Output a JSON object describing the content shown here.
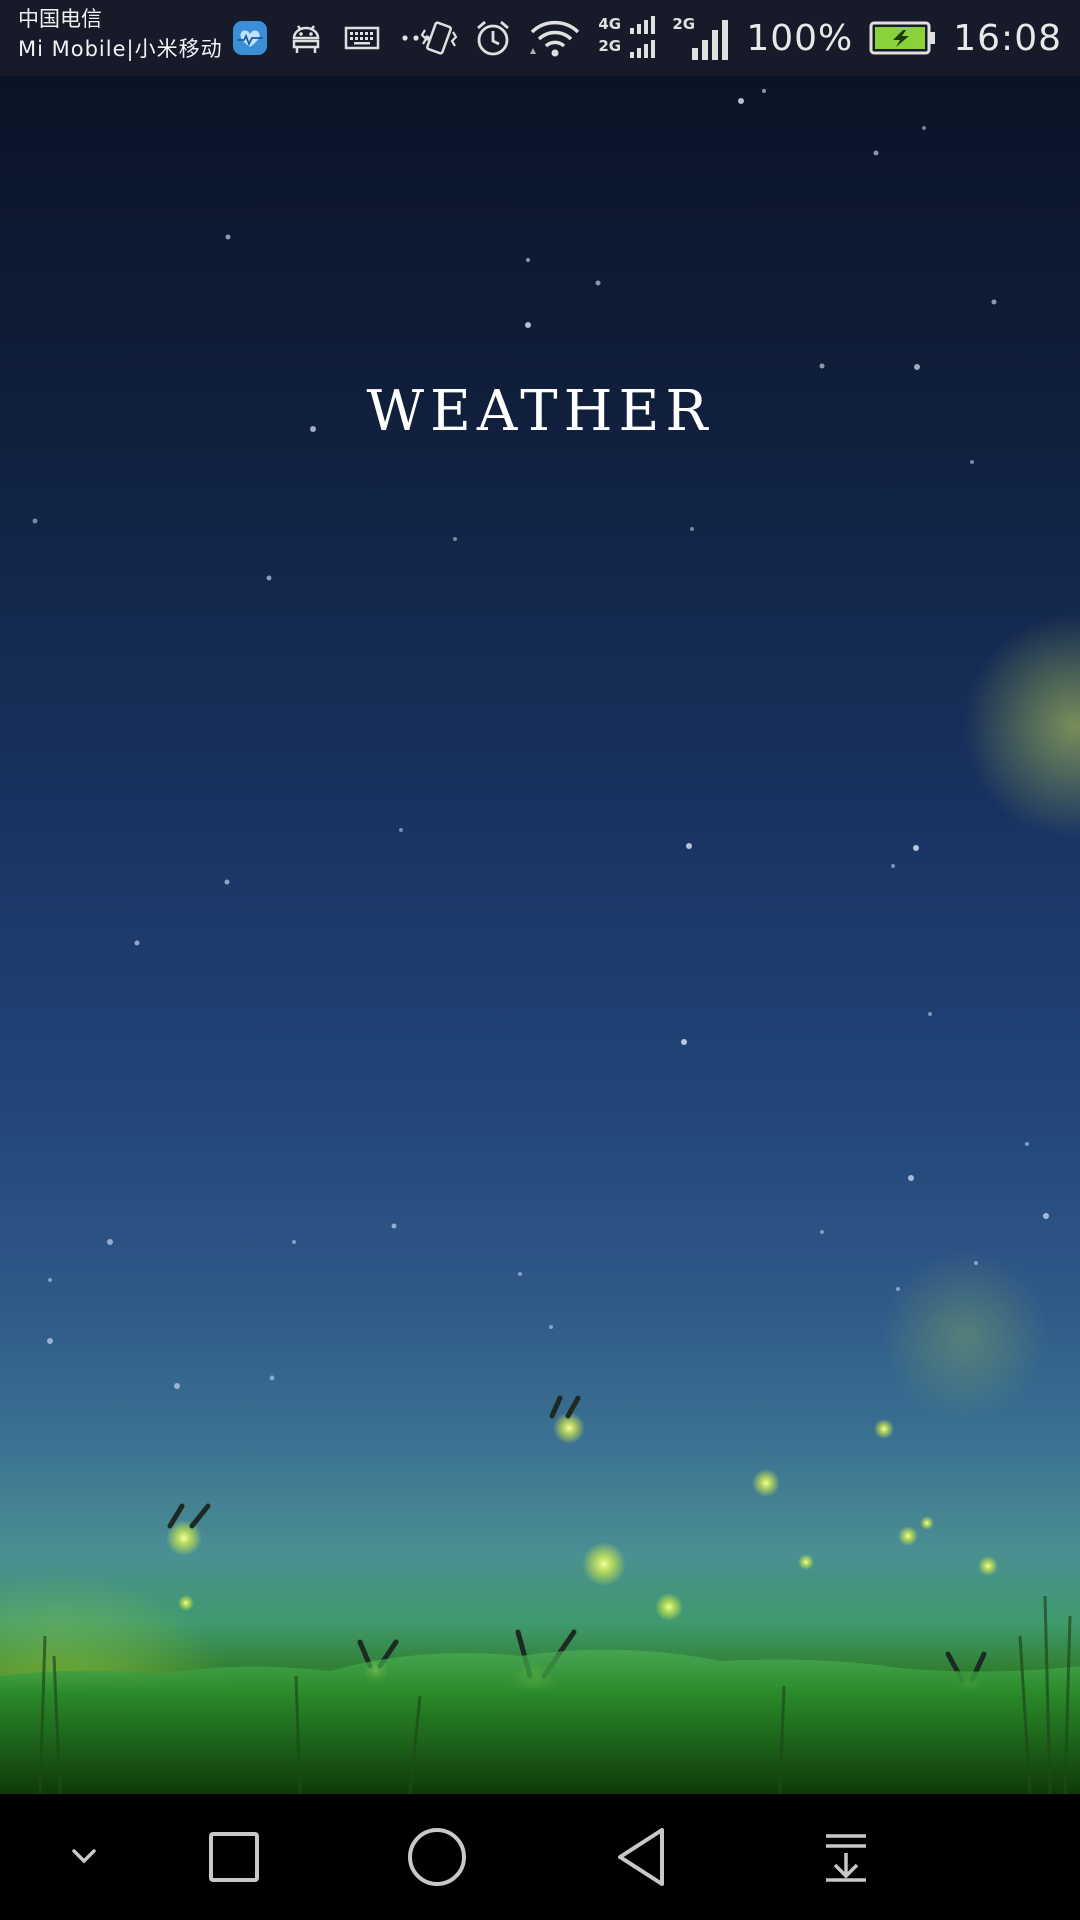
{
  "status_bar": {
    "carrier_line1": "中国电信",
    "carrier_line2": "Mi  Mobile|小米移动",
    "icons": [
      "health-app-icon",
      "android-debug-icon",
      "keyboard-icon",
      "more-dots-icon",
      "vibrate-icon",
      "alarm-icon",
      "wifi-icon",
      "signal-4g-2g-icon",
      "signal-2g-icon",
      "battery-charging-icon"
    ],
    "net_4g": "4G",
    "net_2g_a": "2G",
    "net_2g_b": "2G",
    "battery_percent": "100%",
    "battery_level": 1.0,
    "time": "16:08"
  },
  "app": {
    "title": "WEATHER"
  },
  "nav_bar": {
    "buttons": [
      "hide-nav-icon",
      "recents-icon",
      "home-icon",
      "back-icon",
      "notification-pulldown-icon"
    ]
  },
  "colors": {
    "status_bar_bg": "#171a29",
    "nav_bar_bg": "#000000",
    "sky_top": "#0b1426",
    "sky_bottom": "#4a8f92",
    "grass": "#2f7d2c",
    "firefly": "#e8ff6a",
    "battery_fill": "#8ad23a"
  }
}
